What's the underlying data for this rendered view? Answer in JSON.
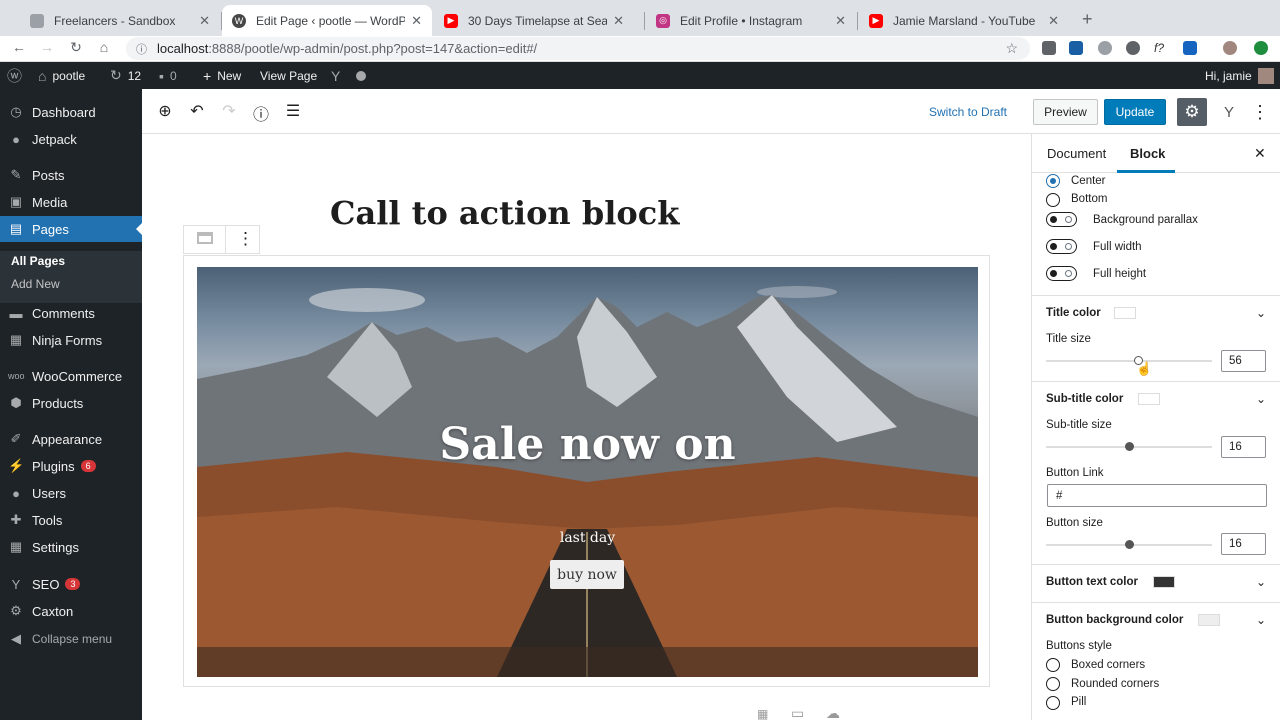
{
  "browser": {
    "tabs": [
      {
        "title": "Freelancers - Sandbox",
        "fav_color": "#9aa0a6"
      },
      {
        "title": "Edit Page ‹ pootle — WordPress",
        "fav_color": "#464646"
      },
      {
        "title": "30 Days Timelapse at Sea | 4K",
        "fav_color": "#ff0000"
      },
      {
        "title": "Edit Profile • Instagram",
        "fav_color": "#c13584"
      },
      {
        "title": "Jamie Marsland - YouTube",
        "fav_color": "#ff0000"
      }
    ],
    "url_host": "localhost",
    "url_rest": ":8888/pootle/wp-admin/post.php?post=147&action=edit#/"
  },
  "adminbar": {
    "site": "pootle",
    "updates": "12",
    "comments": "0",
    "new": "New",
    "view_page": "View Page",
    "greeting": "Hi, jamie"
  },
  "menu": {
    "dashboard": "Dashboard",
    "jetpack": "Jetpack",
    "posts": "Posts",
    "media": "Media",
    "pages": "Pages",
    "all_pages": "All Pages",
    "add_new": "Add New",
    "comments": "Comments",
    "ninja_forms": "Ninja Forms",
    "woocommerce": "WooCommerce",
    "products": "Products",
    "appearance": "Appearance",
    "plugins": "Plugins",
    "plugins_badge": "6",
    "users": "Users",
    "tools": "Tools",
    "settings": "Settings",
    "seo": "SEO",
    "seo_badge": "3",
    "caxton": "Caxton",
    "collapse": "Collapse menu"
  },
  "editor": {
    "switch_draft": "Switch to Draft",
    "preview": "Preview",
    "update": "Update",
    "post_title": "Call to action block",
    "cta_title": "Sale now on",
    "cta_subtitle": "last day",
    "cta_button": "buy now"
  },
  "panel": {
    "tab_document": "Document",
    "tab_block": "Block",
    "opt_center": "Center",
    "opt_bottom": "Bottom",
    "toggle_parallax": "Background parallax",
    "toggle_fullwidth": "Full width",
    "toggle_fullheight": "Full height",
    "title_color": "Title color",
    "title_size_label": "Title size",
    "title_size": "56",
    "subtitle_color": "Sub-title color",
    "subtitle_size_label": "Sub-title size",
    "subtitle_size": "16",
    "button_link_label": "Button Link",
    "button_link": "#",
    "button_size_label": "Button size",
    "button_size": "16",
    "button_text_color": "Button text color",
    "button_bg_color": "Button background color",
    "buttons_style_label": "Buttons style",
    "style_boxed": "Boxed corners",
    "style_rounded": "Rounded corners",
    "style_pill": "Pill"
  },
  "colors": {
    "wp_blue": "#2271b1",
    "update_blue": "#007cba",
    "admin_dark": "#1d2327",
    "title_swatch": "#ffffff",
    "subtitle_swatch": "#ffffff",
    "button_text_swatch": "#333333",
    "button_bg_swatch": "#eeeeee"
  }
}
